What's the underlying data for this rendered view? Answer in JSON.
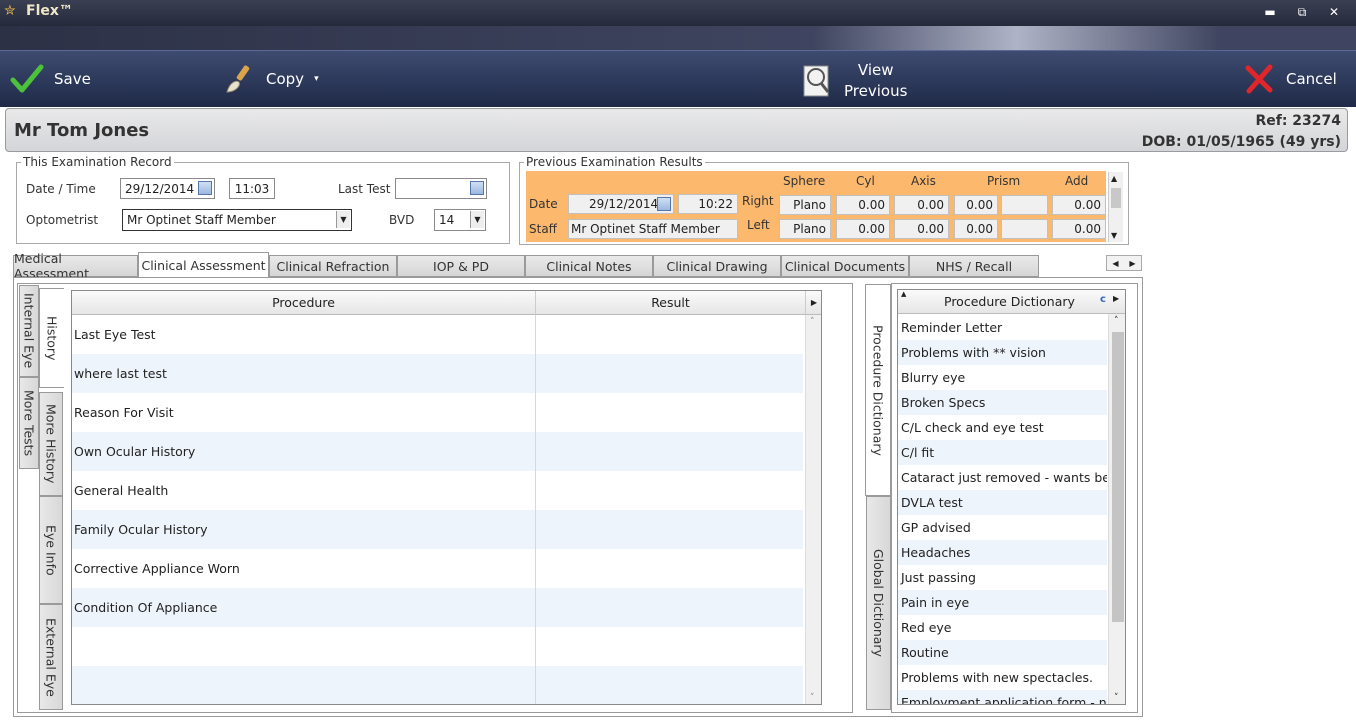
{
  "window": {
    "title": "Flex™"
  },
  "toolbar": {
    "save": "Save",
    "copy": "Copy",
    "view_previous_line1": "View",
    "view_previous_line2": "Previous",
    "cancel": "Cancel"
  },
  "patient": {
    "name": "Mr Tom Jones",
    "ref": "Ref: 23274",
    "dob": "DOB: 01/05/1965 (49 yrs)"
  },
  "exam_record": {
    "legend": "This Examination Record",
    "date_time_label": "Date / Time",
    "date": "29/12/2014",
    "time": "11:03",
    "last_test_label": "Last Test",
    "last_test": "",
    "optometrist_label": "Optometrist",
    "optometrist": "Mr Optinet Staff Member",
    "bvd_label": "BVD",
    "bvd": "14"
  },
  "previous": {
    "legend": "Previous Examination Results",
    "date_label": "Date",
    "staff_label": "Staff",
    "date": "29/12/2014",
    "time": "10:22",
    "staff": "Mr Optinet Staff Member",
    "headers": [
      "Sphere",
      "Cyl",
      "Axis",
      "Prism",
      "Add"
    ],
    "right_label": "Right",
    "left_label": "Left",
    "right": [
      "Plano",
      "0.00",
      "0.00",
      "0.00",
      "",
      "0.00"
    ],
    "left": [
      "Plano",
      "0.00",
      "0.00",
      "0.00",
      "",
      "0.00"
    ]
  },
  "tabs": [
    "Medical Assessment",
    "Clinical Assessment",
    "Clinical Refraction",
    "IOP & PD",
    "Clinical Notes",
    "Clinical Drawing",
    "Clinical Documents",
    "NHS / Recall"
  ],
  "side_tabs_outer": [
    "Internal Eye",
    "More Tests"
  ],
  "side_tabs_inner": [
    "History",
    "More History",
    "Eye Info",
    "External Eye"
  ],
  "grid": {
    "col_procedure": "Procedure",
    "col_result": "Result",
    "rows": [
      "Last Eye Test",
      "where last test",
      "Reason For Visit",
      "Own Ocular History",
      "General Health",
      "Family Ocular History",
      "Corrective Appliance Worn",
      "Condition Of Appliance",
      "",
      ""
    ]
  },
  "right_tabs": [
    "Procedure Dictionary",
    "Global Dictionary"
  ],
  "dictionary": {
    "header": "Procedure Dictionary",
    "items": [
      "Reminder Letter",
      "Problems with ** vision",
      "Blurry eye",
      "Broken Specs",
      "C/L check and eye test",
      "C/l fit",
      "Cataract just removed - wants better",
      "DVLA test",
      "GP advised",
      "Headaches",
      "Just passing",
      "Pain in eye",
      "Red eye",
      "Routine",
      "Problems with new spectacles.",
      "Employment application form - no"
    ]
  },
  "colors": {
    "prev_bg": "#fcb96e",
    "toolbar_bg": "#2a365a",
    "alt_row": "#eef4fb"
  }
}
